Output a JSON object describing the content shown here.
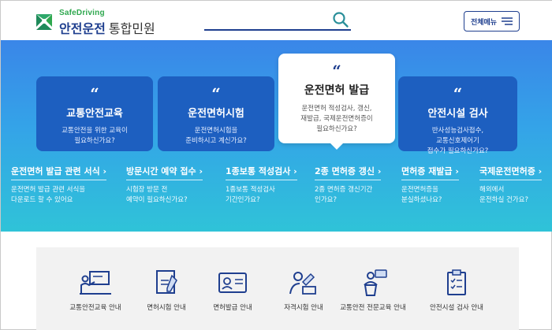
{
  "header": {
    "logo_sub": "SafeDriving",
    "logo_main": "안전운전",
    "logo_tail": "통합민원",
    "search_placeholder": "",
    "menu_label": "전체메뉴"
  },
  "colors": {
    "primary": "#1f3f8f",
    "accent_green": "#2fa84f",
    "hero_top": "#3a86e8",
    "hero_bottom": "#2fc3d8",
    "card": "#1d5fc0"
  },
  "cards": [
    {
      "quote": "“",
      "title": "교통안전교육",
      "desc1": "교통안전을 위한 교육이",
      "desc2": "필요하신가요?",
      "desc3": ""
    },
    {
      "quote": "“",
      "title": "운전면허시험",
      "desc1": "운전면허시험을",
      "desc2": "준비하시고 계신가요?",
      "desc3": ""
    },
    {
      "quote": "“",
      "title": "운전면허 발급",
      "desc1": "운전면허 적성검사, 갱신,",
      "desc2": "재발급, 국제운전면허증이",
      "desc3": "필요하신가요?"
    },
    {
      "quote": "“",
      "title": "안전시설 검사",
      "desc1": "반사성능검사접수,",
      "desc2": "교통신호제어기",
      "desc3": "접수가 필요하신가요?"
    }
  ],
  "links": [
    {
      "title": "운전면허 발급 관련 서식 ›",
      "desc1": "운전면허 발급 관련 서식을",
      "desc2": "다운로드 할 수 있어요"
    },
    {
      "title": "방문시간 예약 접수 ›",
      "desc1": "시험장 방문 전",
      "desc2": "예약이 필요하신가요?"
    },
    {
      "title": "1종보통 적성검사 ›",
      "desc1": "1종보통 적성검사",
      "desc2": "기간인가요?"
    },
    {
      "title": "2종 면허증 갱신 ›",
      "desc1": "2종 면허증 갱신기간",
      "desc2": "인가요?"
    },
    {
      "title": "면허증 재발급 ›",
      "desc1": "운전면허증을",
      "desc2": "분실하셨나요?"
    },
    {
      "title": "국제운전면허증 ›",
      "desc1": "해외에서",
      "desc2": "운전하실 건가요?"
    }
  ],
  "services": [
    {
      "label": "교통안전교육 안내",
      "icon": "lecture-icon"
    },
    {
      "label": "면허시험 안내",
      "icon": "exam-icon"
    },
    {
      "label": "면허발급 안내",
      "icon": "license-card-icon"
    },
    {
      "label": "자격시험 안내",
      "icon": "certification-icon"
    },
    {
      "label": "교통안전 전문교육 안내",
      "icon": "speaker-podium-icon"
    },
    {
      "label": "안전시설 검사 안내",
      "icon": "checklist-icon"
    }
  ]
}
